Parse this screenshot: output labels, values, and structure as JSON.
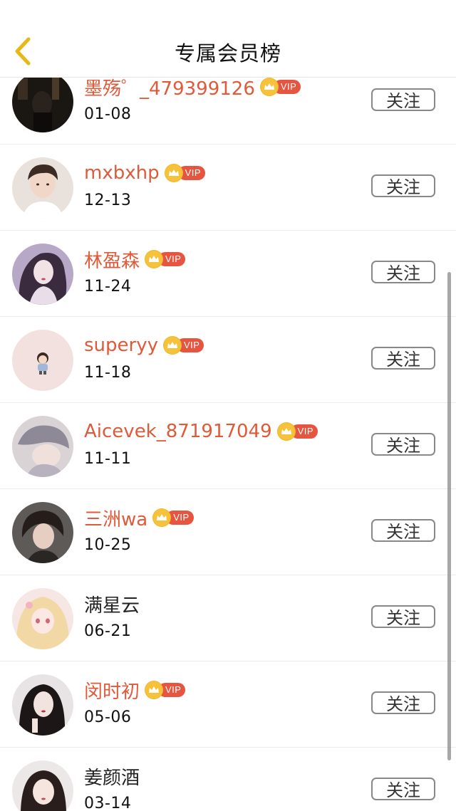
{
  "header": {
    "title": "专属会员榜"
  },
  "follow_label": "关注",
  "vip_label": "VIP",
  "members": [
    {
      "name": "墨殇゜_479399126",
      "date": "01-08",
      "vip": true
    },
    {
      "name": "mxbxhp",
      "date": "12-13",
      "vip": true
    },
    {
      "name": "林盈森",
      "date": "11-24",
      "vip": true
    },
    {
      "name": "superyy",
      "date": "11-18",
      "vip": true
    },
    {
      "name": "Aicevek_871917049",
      "date": "11-11",
      "vip": true
    },
    {
      "name": "三洲wa",
      "date": "10-25",
      "vip": true
    },
    {
      "name": "满星云",
      "date": "06-21",
      "vip": false
    },
    {
      "name": "闵时初",
      "date": "05-06",
      "vip": true
    },
    {
      "name": "姜颜酒",
      "date": "03-14",
      "vip": false
    }
  ],
  "colors": {
    "vip_name": "#e05a3a",
    "vip_badge": "#e5553f",
    "crown": "#f6c23b",
    "back_arrow": "#e8b818"
  }
}
